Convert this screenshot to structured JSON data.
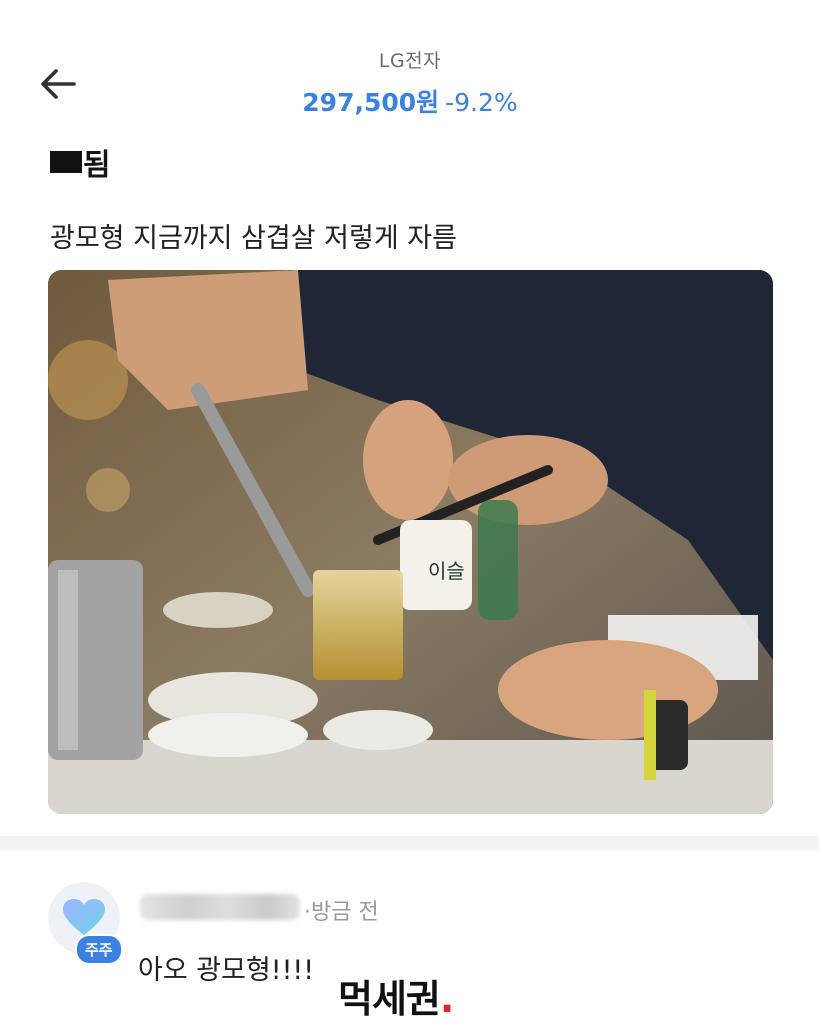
{
  "header": {
    "stock_name": "LG전자",
    "price": "297,500원",
    "change": "-9.2%"
  },
  "post": {
    "title_suffix": "됨",
    "body": "광모형 지금까지 삼겹살 저렇게 자름",
    "photo_bottle_label": "이슬"
  },
  "comment": {
    "badge": "주주",
    "time": "·방금 전",
    "text": "아오 광모형!!!!"
  },
  "watermark": {
    "text": "먹세권",
    "dot": "."
  },
  "colors": {
    "accent": "#3b82e0",
    "watermark_dot": "#e0242b"
  },
  "icons": {
    "back": "arrow-left-icon",
    "avatar": "heart-icon"
  }
}
